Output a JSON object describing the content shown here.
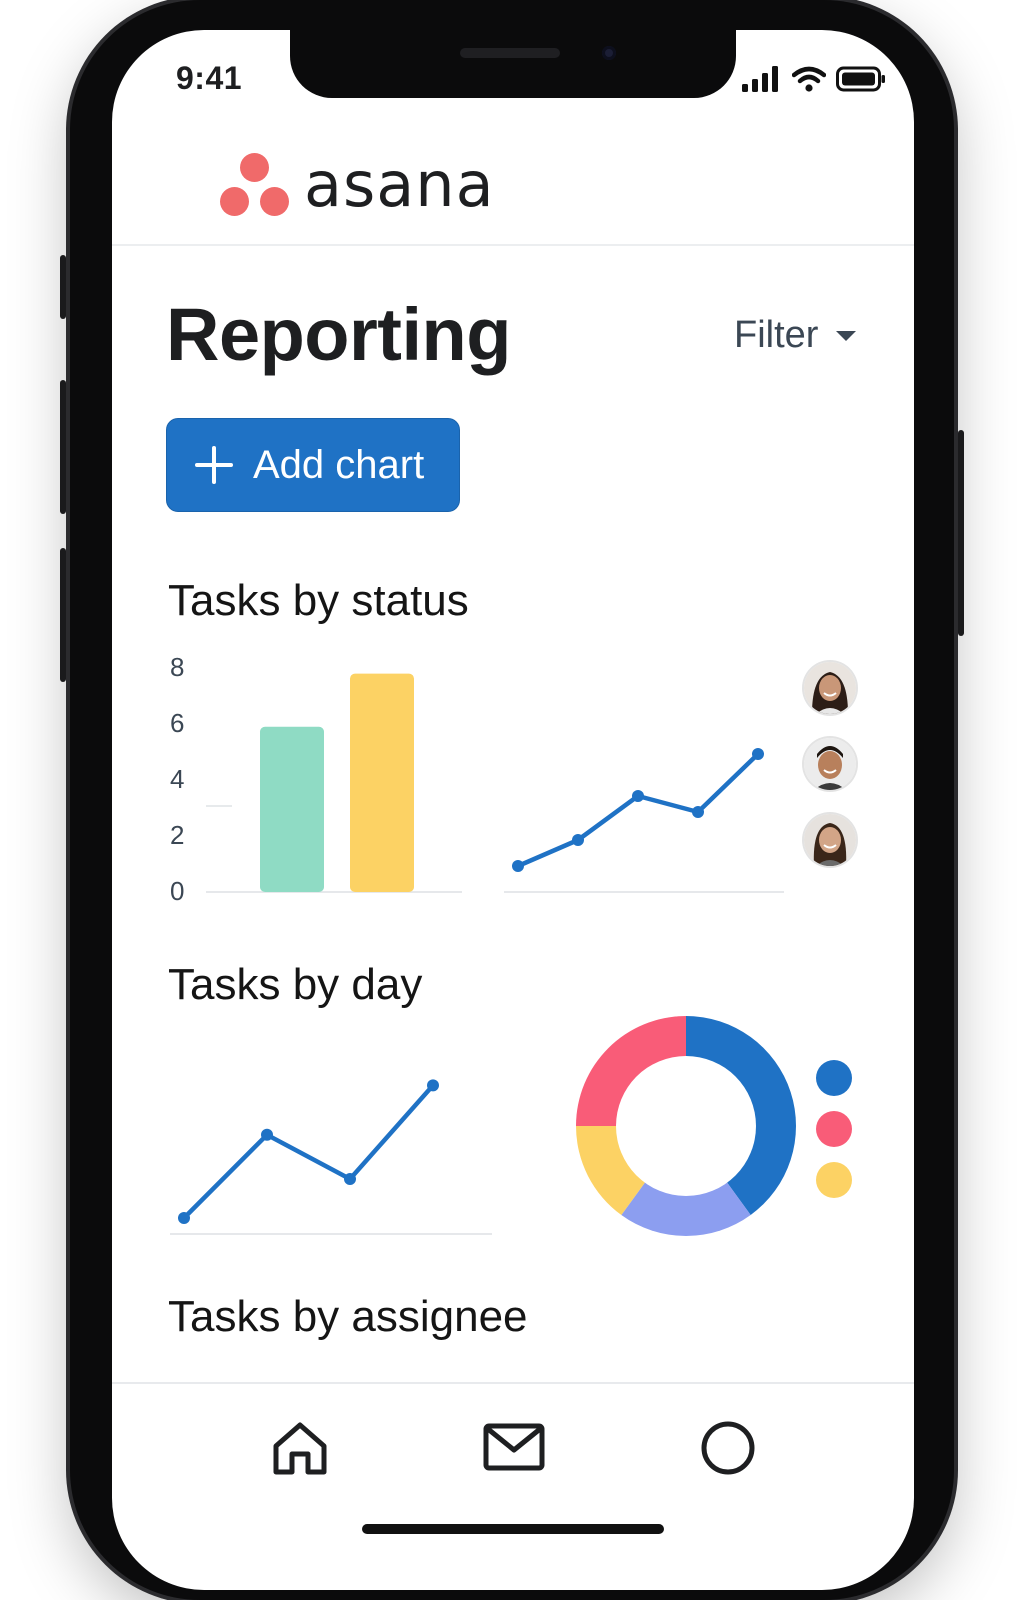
{
  "status_bar": {
    "time": "9:41"
  },
  "brand": {
    "name": "asana",
    "color": "#f06a6a"
  },
  "page": {
    "title": "Reporting",
    "filter_label": "Filter"
  },
  "actions": {
    "add_chart_label": "Add chart",
    "accent": "#1f72c5"
  },
  "sections": {
    "status_title": "Tasks by status",
    "day_title": "Tasks by day",
    "assignee_title": "Tasks by assignee"
  },
  "avatars": [
    "avatar-woman-1",
    "avatar-man",
    "avatar-woman-2"
  ],
  "bottom_nav": [
    "home-icon",
    "mail-icon",
    "circle-icon"
  ],
  "chart_data": [
    {
      "type": "bar",
      "yticks": [
        "8",
        "6",
        "4",
        "2",
        "0"
      ],
      "ylim": [
        0,
        8
      ],
      "values": [
        5.9,
        7.8
      ],
      "colors": [
        "#8fdbc4",
        "#fcd264"
      ]
    },
    {
      "type": "line",
      "values": [
        1.6,
        2.9,
        5.1,
        4.3,
        7.2
      ],
      "color": "#1f72c5"
    },
    {
      "type": "line",
      "values": [
        1.0,
        4.2,
        2.5,
        6.1
      ],
      "color": "#1f72c5"
    },
    {
      "type": "pie",
      "values": [
        40,
        20,
        15,
        25
      ],
      "colors": [
        "#1f72c5",
        "#8c9ef0",
        "#fcd264",
        "#f95c78"
      ],
      "legend_colors": [
        "#1f72c5",
        "#f95c78",
        "#fcd264"
      ]
    }
  ]
}
